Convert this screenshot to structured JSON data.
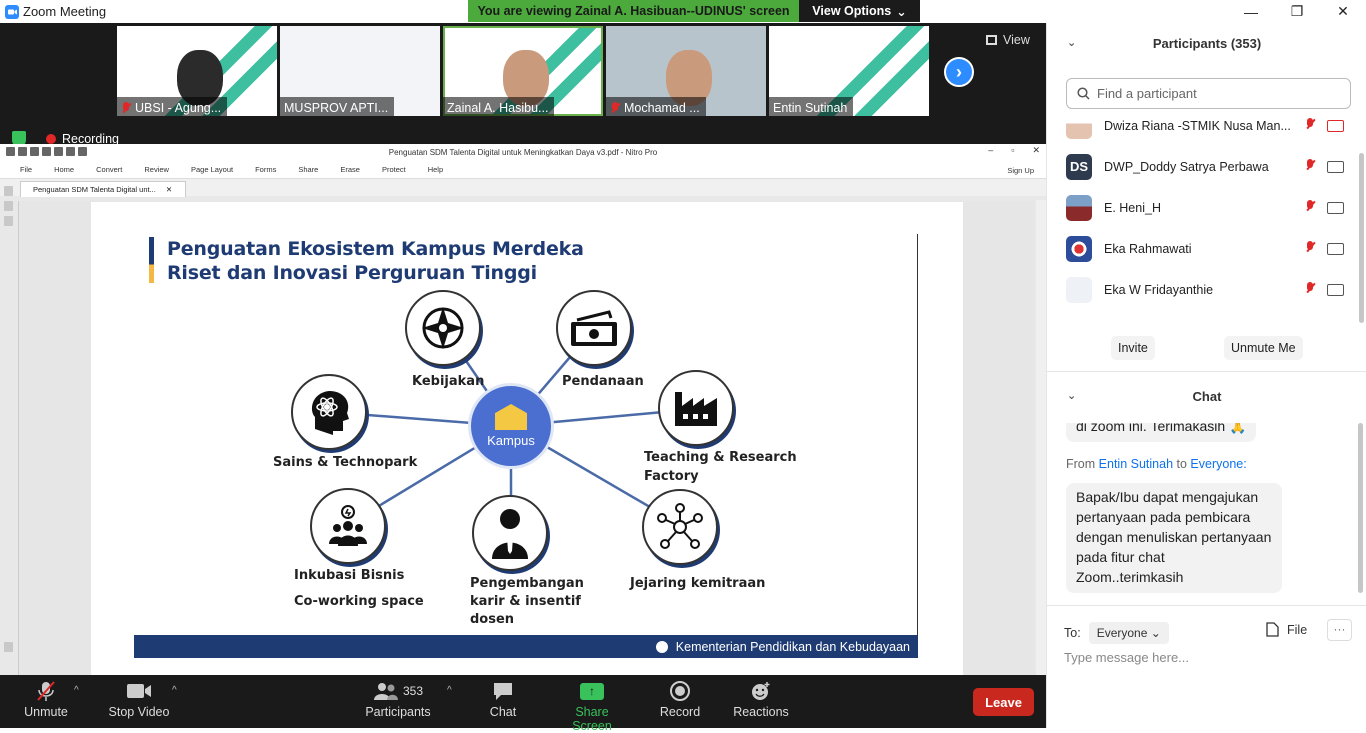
{
  "window": {
    "title": "Zoom Meeting",
    "minimize": "—",
    "restore": "❐",
    "close": "✕"
  },
  "banner": {
    "message": "You are viewing Zainal A. Hasibuan--UDINUS' screen",
    "options_label": "View Options",
    "options_caret": "⌄"
  },
  "thumbnails": [
    {
      "label": "UBSI - Agung...",
      "muted": true
    },
    {
      "label": "MUSPROV APTI...",
      "muted": false
    },
    {
      "label": "Zainal A. Hasibu...",
      "muted": false
    },
    {
      "label": "Mochamad ...",
      "muted": true
    },
    {
      "label": "Entin Sutinah",
      "muted": false
    }
  ],
  "gallery": {
    "next_label": "›",
    "view_label": "View"
  },
  "recording": {
    "label": "Recording"
  },
  "nitro": {
    "title": "Penguatan SDM Talenta Digital untuk Meningkatkan Daya v3.pdf - Nitro Pro",
    "menu": [
      "File",
      "Home",
      "Convert",
      "Review",
      "Page Layout",
      "Forms",
      "Share",
      "Erase",
      "Protect",
      "Help"
    ],
    "sign_up": "Sign Up",
    "doc_tab": "Penguatan SDM Talenta Digital unt...",
    "doc_tab_close": "✕"
  },
  "slide": {
    "title_line1": "Penguatan Ekosistem Kampus Merdeka",
    "title_line2": "Riset dan Inovasi Perguruan Tinggi",
    "hub": "Kampus",
    "nodes": {
      "kebijakan": "Kebijakan",
      "pendanaan": "Pendanaan",
      "sains": "Sains & Technopark",
      "teaching1": "Teaching & Research",
      "teaching2": "Factory",
      "inkubasi1": "Inkubasi Bisnis",
      "inkubasi2": "Co-working space",
      "pengembangan1": "Pengembangan",
      "pengembangan2": "karir & insentif",
      "pengembangan3": "dosen",
      "jejaring": "Jejaring kemitraan"
    },
    "footer": "Kementerian Pendidikan dan Kebudayaan"
  },
  "toolbar": {
    "unmute": "Unmute",
    "stop_video": "Stop Video",
    "participants": "Participants",
    "participants_count": "353",
    "chat": "Chat",
    "share_screen": "Share Screen",
    "record": "Record",
    "reactions": "Reactions",
    "leave": "Leave",
    "caret": "^"
  },
  "participants_panel": {
    "header": "Participants (353)",
    "search_placeholder": "Find a participant",
    "rows": [
      {
        "name": "Dwiza Riana -STMIK Nusa Man...",
        "avatar_text": "",
        "video_off": true
      },
      {
        "name": "DWP_Doddy Satrya Perbawa",
        "avatar_text": "DS",
        "video_off": false
      },
      {
        "name": "E. Heni_H",
        "avatar_text": "",
        "video_off": false
      },
      {
        "name": "Eka Rahmawati",
        "avatar_text": "",
        "video_off": false
      },
      {
        "name": "Eka W Fridayanthie",
        "avatar_text": "",
        "video_off": false
      }
    ],
    "invite": "Invite",
    "unmute_me": "Unmute Me"
  },
  "chat_panel": {
    "header": "Chat",
    "prev_message": "di zoom ini. Terimakasih 🙏",
    "from_label": "From",
    "from_name": "Entin Sutinah",
    "to_word": "to",
    "to_name": "Everyone:",
    "message": "Bapak/Ibu dapat mengajukan pertanyaan pada pembicara dengan menuliskan pertanyaan pada fitur chat Zoom..terimkasih",
    "to_label": "To:",
    "to_select": "Everyone",
    "file": "File",
    "more": "···",
    "input_placeholder": "Type message here..."
  },
  "colors": {
    "accent": "#2d8cff",
    "banner_green": "#4caa3c",
    "leave_red": "#c8281e",
    "slide_navy": "#1f3b73",
    "hub_blue": "#4a6fd0"
  }
}
